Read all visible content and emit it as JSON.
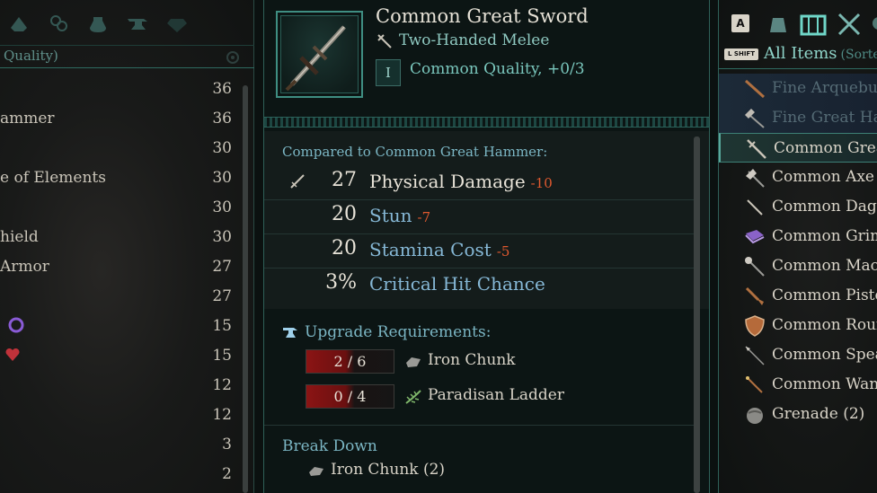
{
  "left": {
    "header": "Quality)",
    "rows": [
      {
        "name": "",
        "value": "36"
      },
      {
        "name": "ammer",
        "value": "36"
      },
      {
        "name": "",
        "value": "30"
      },
      {
        "name": "e of Elements",
        "value": "30"
      },
      {
        "name": "",
        "value": "30"
      },
      {
        "name": "hield",
        "value": "30"
      },
      {
        "name": " Armor",
        "value": "27"
      },
      {
        "name": "",
        "value": "27"
      },
      {
        "name": "",
        "value": "15"
      },
      {
        "name": "",
        "value": "15"
      },
      {
        "name": "",
        "value": "12"
      },
      {
        "name": "",
        "value": "12"
      },
      {
        "name": "",
        "value": "3"
      },
      {
        "name": "",
        "value": "2"
      }
    ]
  },
  "item": {
    "title": "Common Great Sword",
    "subtitle": "Two-Handed Melee",
    "quality_badge": "I",
    "quality_text": "Common Quality, +0/3"
  },
  "stats": {
    "compare_label": "Compared to Common Great Hammer:",
    "rows": [
      {
        "value": "27",
        "name": "Physical Damage",
        "diff": "-10",
        "color": "#e8e3d8"
      },
      {
        "value": "20",
        "name": "Stun",
        "diff": "-7",
        "color": "#86b8d6"
      },
      {
        "value": "20",
        "name": "Stamina Cost",
        "diff": "-5",
        "color": "#86b8d6"
      },
      {
        "value": "3%",
        "name": "Critical Hit Chance",
        "diff": "",
        "color": "#86b8d6"
      }
    ]
  },
  "upgrade": {
    "title": "Upgrade Requirements:",
    "reqs": [
      {
        "count": "2 / 6",
        "name": "Iron Chunk"
      },
      {
        "count": "0 / 4",
        "name": "Paradisan Ladder"
      }
    ]
  },
  "breakdown": {
    "title": "Break Down",
    "item": "Iron Chunk (2)"
  },
  "right": {
    "key_a": "A",
    "key_shift": "L SHIFT",
    "title": "All Items",
    "sorted": "(Sorted",
    "items": [
      "Fine Arquebus",
      "Fine Great Har",
      "Common Grea",
      "Common Axe",
      "Common Dagg",
      "Common Grim",
      "Common Mace",
      "Common Pisto",
      "Common Roun",
      "Common Spear",
      "Common Wan",
      "Grenade (2)"
    ]
  },
  "icons": {
    "left_tabs": [
      "armor-icon",
      "trinket-icon",
      "consumable-icon",
      "anvil-icon",
      "gem-icon"
    ],
    "right_tabs": [
      "bag-icon",
      "chest-icon",
      "crossed-swords-icon"
    ],
    "right_item_icons": [
      "arquebus-icon",
      "hammer-icon",
      "sword-icon",
      "axe-icon",
      "dagger-icon",
      "grimoire-icon",
      "mace-icon",
      "pistol-icon",
      "shield-icon",
      "spear-icon",
      "wand-icon",
      "grenade-icon"
    ]
  }
}
